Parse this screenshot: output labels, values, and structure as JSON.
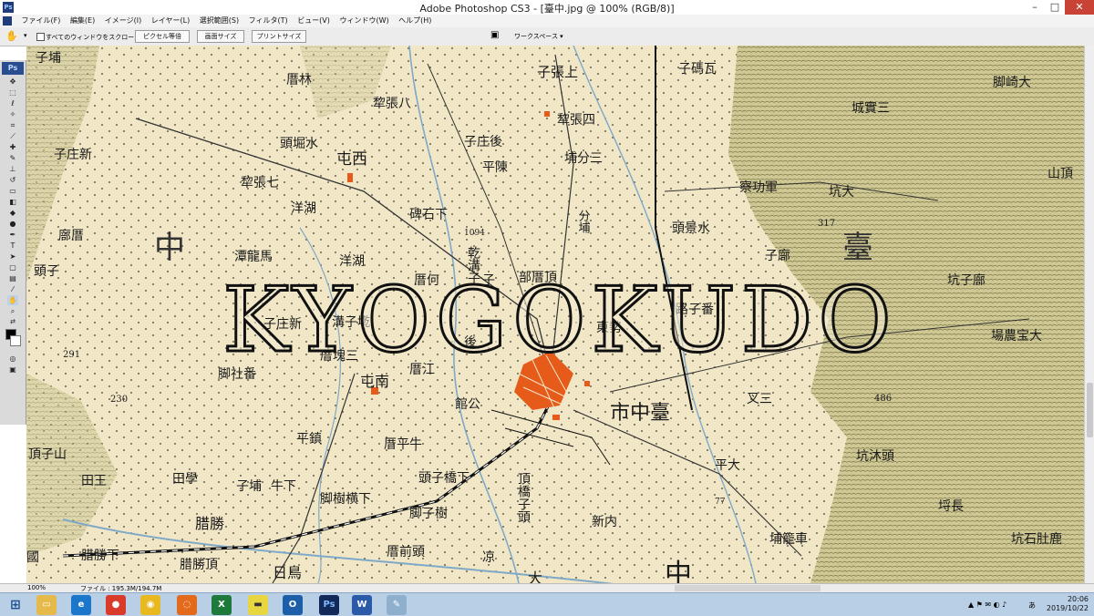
{
  "window": {
    "title": "Adobe Photoshop CS3 - [臺中.jpg @ 100% (RGB/8)]",
    "app_badge": "Ps",
    "controls": [
      "–",
      "□",
      "✕"
    ]
  },
  "menu": [
    "ファイル(F)",
    "編集(E)",
    "イメージ(I)",
    "レイヤー(L)",
    "選択範囲(S)",
    "フィルタ(T)",
    "ビュー(V)",
    "ウィンドウ(W)",
    "ヘルプ(H)"
  ],
  "options": {
    "checkbox_label": "すべてのウィンドウをスクロール",
    "buttons": [
      "ピクセル等倍",
      "画面サイズ",
      "プリントサイズ"
    ],
    "workspace": "ワークスペース ▾"
  },
  "toolbox": {
    "logo": "Ps"
  },
  "map": {
    "watermark": "KYOGOKUDO",
    "labels": [
      "子埔",
      "子張上",
      "子碼瓦",
      "脚崎大",
      "厝林",
      "犂張八",
      "犂張四",
      "城實三",
      "子庄新",
      "頭堀水",
      "屯西",
      "子庄後",
      "埔分三",
      "山頂",
      "犂張七",
      "平陳",
      "察功軍",
      "坑大",
      "洋湖",
      "碑石下",
      "分埔",
      "頭景水",
      "317",
      "子廍",
      "廍厝",
      "中",
      "潭龍馬",
      "乾溝子",
      "部厝頂",
      "路子番",
      "坑子廍",
      "頭子",
      "1094",
      "洋湖",
      "厝何",
      "東勢",
      "子庄新",
      "溝子墘",
      "子",
      "後",
      "場農宝大",
      "291",
      "厝塊三",
      "脚社番",
      "屯南",
      "厝江",
      "叉三",
      "230",
      "館公",
      "市中臺",
      "486",
      "頂子山",
      "平鎮",
      "厝平牛",
      "平大",
      "坑沐頭",
      "田王",
      "田學",
      "子埔",
      "牛下",
      "頭子橋下",
      "頂橋子頭",
      "脚樹横下",
      "脚子樹",
      "埒長",
      "腊勝",
      "新内",
      "坑石肚鹿",
      "埔籠車",
      "腊勝下",
      "腊勝頂",
      "厝前頭",
      "凉",
      "日鳥",
      "大",
      "臺",
      "中",
      "國",
      "77"
    ]
  },
  "status": {
    "zoom": "100%",
    "file": "ファイル : 195.3M/194.7M"
  },
  "taskbar": {
    "apps": [
      "Explorer",
      "IE",
      "Stop",
      "Chrome",
      "Firefox",
      "Excel",
      "Notes",
      "Outlook",
      "Ps",
      "Word",
      "Paint"
    ],
    "time": "20:06",
    "date": "2019/10/22",
    "ime": "あ"
  }
}
